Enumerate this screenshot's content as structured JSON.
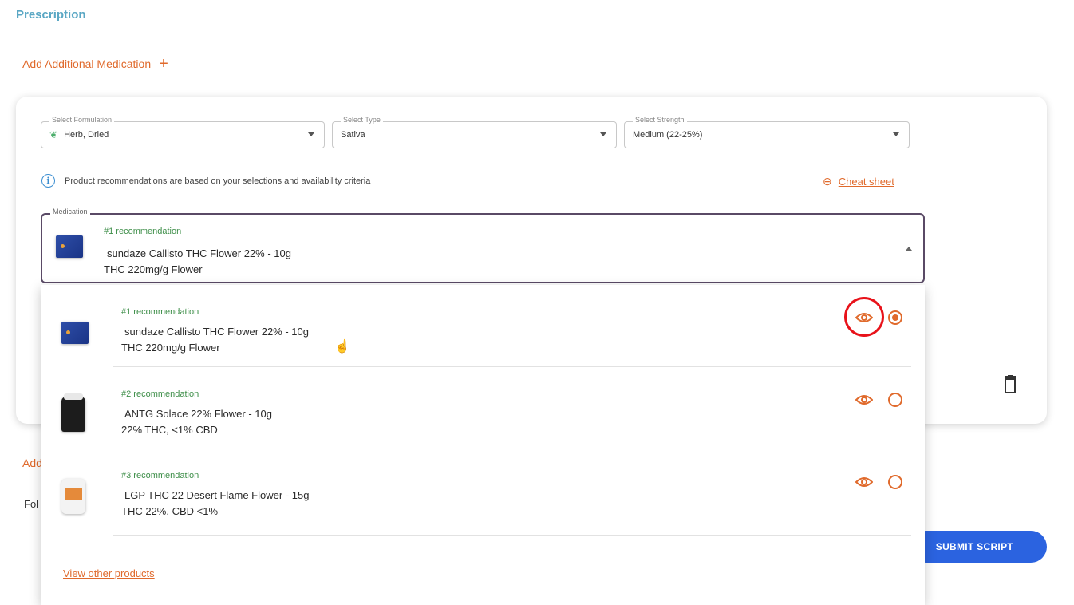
{
  "section": {
    "title": "Prescription"
  },
  "add_medication": {
    "label": "Add Additional Medication",
    "icon": "plus-icon"
  },
  "filters": {
    "formulation": {
      "label": "Select Formulation",
      "value": "Herb, Dried",
      "icon": "leaf-icon"
    },
    "type": {
      "label": "Select Type",
      "value": "Sativa"
    },
    "strength": {
      "label": "Select Strength",
      "value": "Medium (22-25%)"
    }
  },
  "info": {
    "text": "Product recommendations are based on your selections and availability criteria",
    "icon": "info-icon"
  },
  "cheat_sheet": {
    "label": "Cheat sheet",
    "icon": "link-icon"
  },
  "medication": {
    "label": "Medication",
    "selected": {
      "tag": "#1 recommendation",
      "name": "sundaze Callisto THC Flower 22% - 10g",
      "desc": "THC 220mg/g Flower"
    }
  },
  "options": [
    {
      "tag": "#1 recommendation",
      "name": "sundaze Callisto THC Flower 22% - 10g",
      "desc": "THC 220mg/g Flower",
      "selected": true
    },
    {
      "tag": "#2 recommendation",
      "name": "ANTG Solace 22% Flower - 10g",
      "desc": "22% THC, <1% CBD",
      "selected": false
    },
    {
      "tag": "#3 recommendation",
      "name": "LGP THC 22 Desert Flame Flower - 15g",
      "desc": "THC 22%, CBD <1%",
      "selected": false
    }
  ],
  "view_other": "View other products",
  "partial": {
    "add": "Add",
    "fol": "Fol"
  },
  "submit": "SUBMIT SCRIPT",
  "colors": {
    "accent": "#e06a2c",
    "title": "#5aa7c4",
    "submit": "#2b63e0",
    "highlight": "#e8121a"
  }
}
